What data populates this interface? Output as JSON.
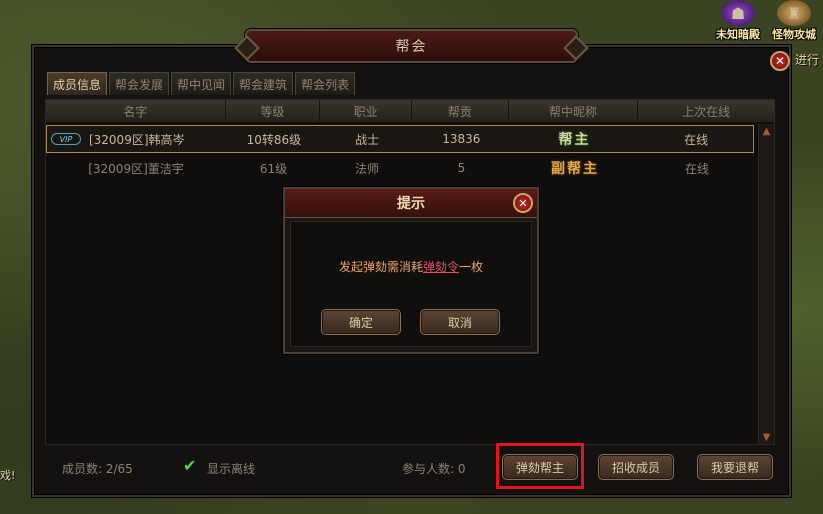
{
  "hud": {
    "icon1_label": "未知暗殿",
    "icon2_label": "怪物攻城",
    "side_link": "进行",
    "left_edge_text": "戏!"
  },
  "window": {
    "title": "帮会",
    "close_symbol": "✕"
  },
  "tabs": [
    {
      "label": "成员信息",
      "active": true
    },
    {
      "label": "帮会发展",
      "active": false
    },
    {
      "label": "帮中见闻",
      "active": false
    },
    {
      "label": "帮会建筑",
      "active": false
    },
    {
      "label": "帮会列表",
      "active": false
    }
  ],
  "table": {
    "headers": [
      "名字",
      "等级",
      "职业",
      "帮贡",
      "帮中昵称",
      "上次在线"
    ],
    "rows": [
      {
        "vip": "VIP",
        "name": "[32009区]韩高岑",
        "level": "10转86级",
        "job": "战士",
        "contribution": "13836",
        "rank": "帮主",
        "last_online": "在线"
      },
      {
        "vip": "",
        "name": "[32009区]董洁宇",
        "level": "61级",
        "job": "法师",
        "contribution": "5",
        "rank": "副帮主",
        "last_online": "在线"
      }
    ]
  },
  "footer": {
    "member_count": "成员数: 2/65",
    "show_offline": "显示离线",
    "participants": "参与人数: 0",
    "impeach_button": "弹劾帮主",
    "recruit_button": "招收成员",
    "quit_button": "我要退帮"
  },
  "dialog": {
    "title": "提示",
    "msg_prefix": "发起弹劾需消耗",
    "msg_item": "弹劾令",
    "msg_suffix": "一枚",
    "confirm": "确定",
    "cancel": "取消"
  },
  "colors": {
    "highlight_box": "#e0141a",
    "leader_rank": "#c9dba0",
    "vice_rank": "#e3a94b"
  }
}
